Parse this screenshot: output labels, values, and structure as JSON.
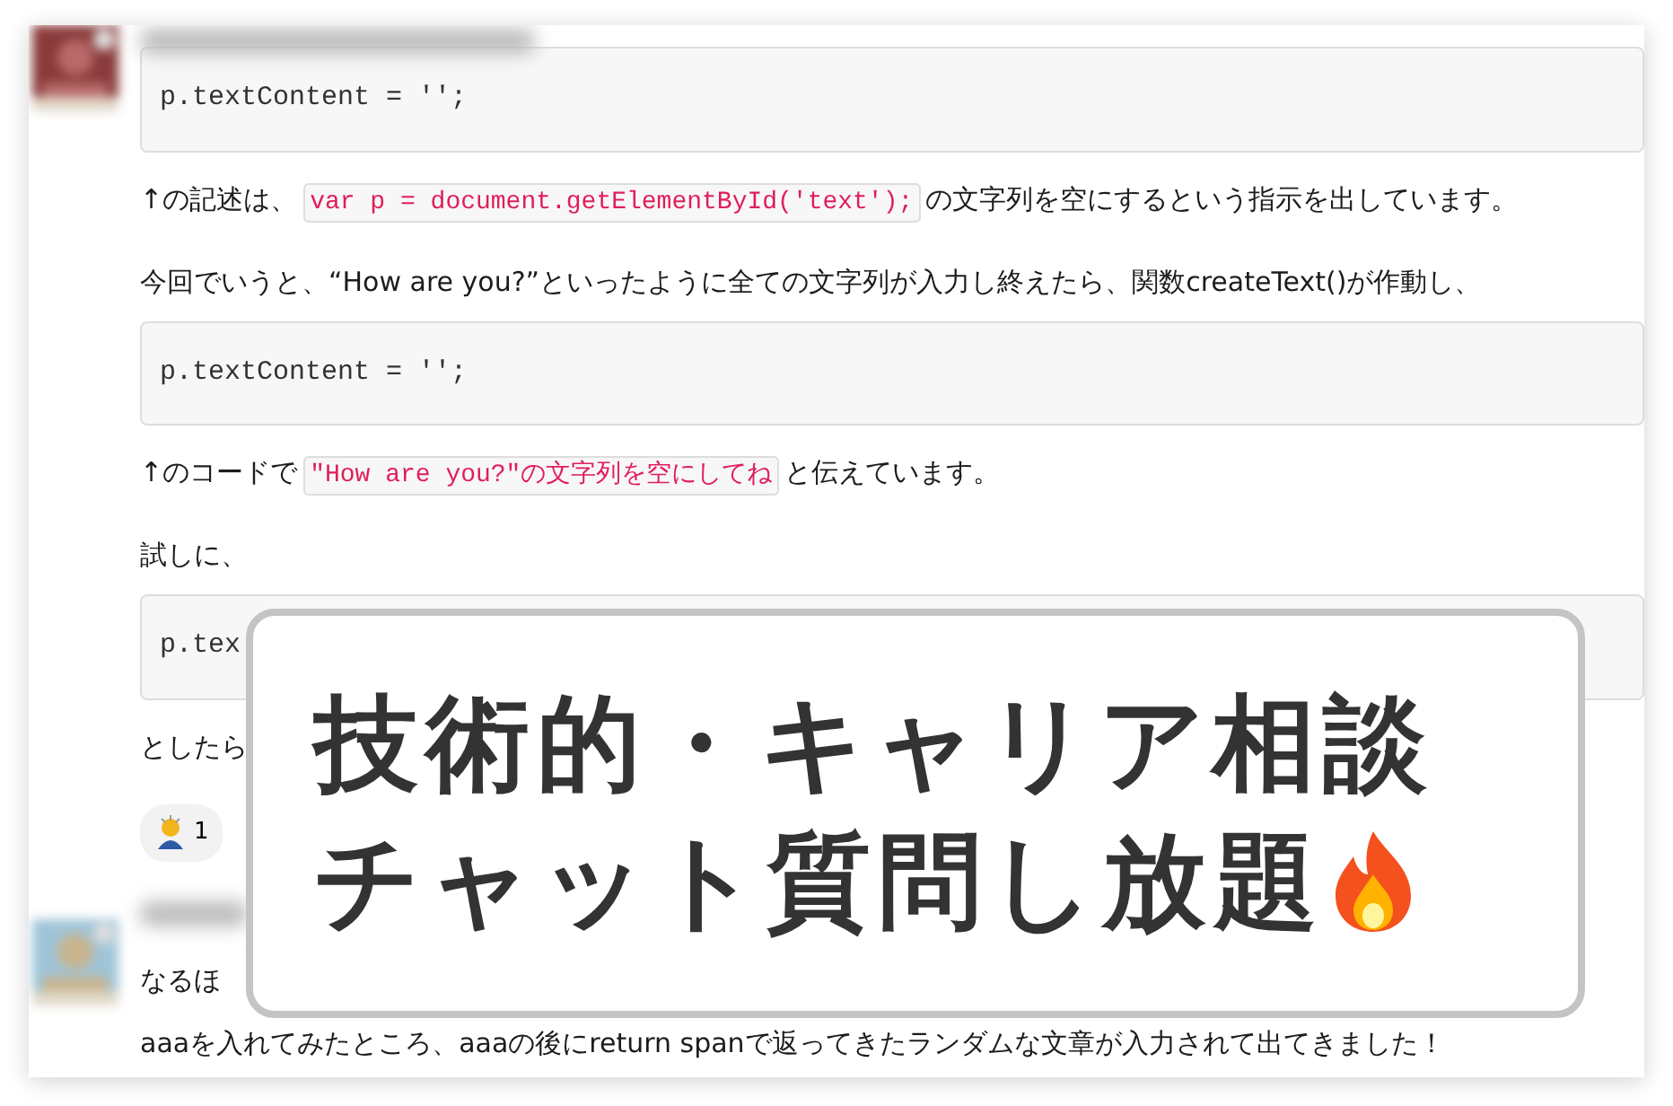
{
  "messages": [
    {
      "avatar": {
        "kind": "picture"
      },
      "blocks": [
        {
          "kind": "code_block",
          "text": "p.textContent = '';"
        },
        {
          "kind": "paragraph",
          "segments": [
            {
              "text": "↑の記述は、",
              "code": false
            },
            {
              "text": "var p = document.getElementById('text');",
              "code": true
            },
            {
              "text": "の文字列を空にするという指示を出しています。",
              "code": false
            }
          ]
        },
        {
          "kind": "paragraph",
          "segments": [
            {
              "text": "今回でいうと、“How are you?”といったように全ての文字列が入力し終えたら、関数createText()が作動し、",
              "code": false
            }
          ]
        },
        {
          "kind": "code_block",
          "text": "p.textContent = '';"
        },
        {
          "kind": "paragraph",
          "segments": [
            {
              "text": "↑のコードで",
              "code": false
            },
            {
              "text": "\"How are you?\"の文字列を空にしてね",
              "code": true
            },
            {
              "text": "と伝えています。",
              "code": false
            }
          ]
        },
        {
          "kind": "paragraph",
          "segments": [
            {
              "text": "試しに、",
              "code": false
            }
          ]
        },
        {
          "kind": "code_block",
          "text": "p.tex"
        },
        {
          "kind": "paragraph",
          "segments": [
            {
              "text": "としたら",
              "code": false
            }
          ]
        },
        {
          "kind": "reactions",
          "items": [
            {
              "count": "1"
            }
          ]
        }
      ]
    },
    {
      "avatar": {
        "kind": "picture"
      },
      "blocks": [
        {
          "kind": "paragraph",
          "segments": [
            {
              "text": "なるほ",
              "code": false
            }
          ]
        },
        {
          "kind": "paragraph",
          "segments": [
            {
              "text": "aaaを入れてみたところ、aaaの後にreturn spanで返ってきたランダムな文章が入力されて出てきました！",
              "code": false
            }
          ]
        }
      ]
    }
  ],
  "overlay": {
    "lines": [
      "技術的・キャリア相談",
      "チャット質問し放題"
    ]
  }
}
